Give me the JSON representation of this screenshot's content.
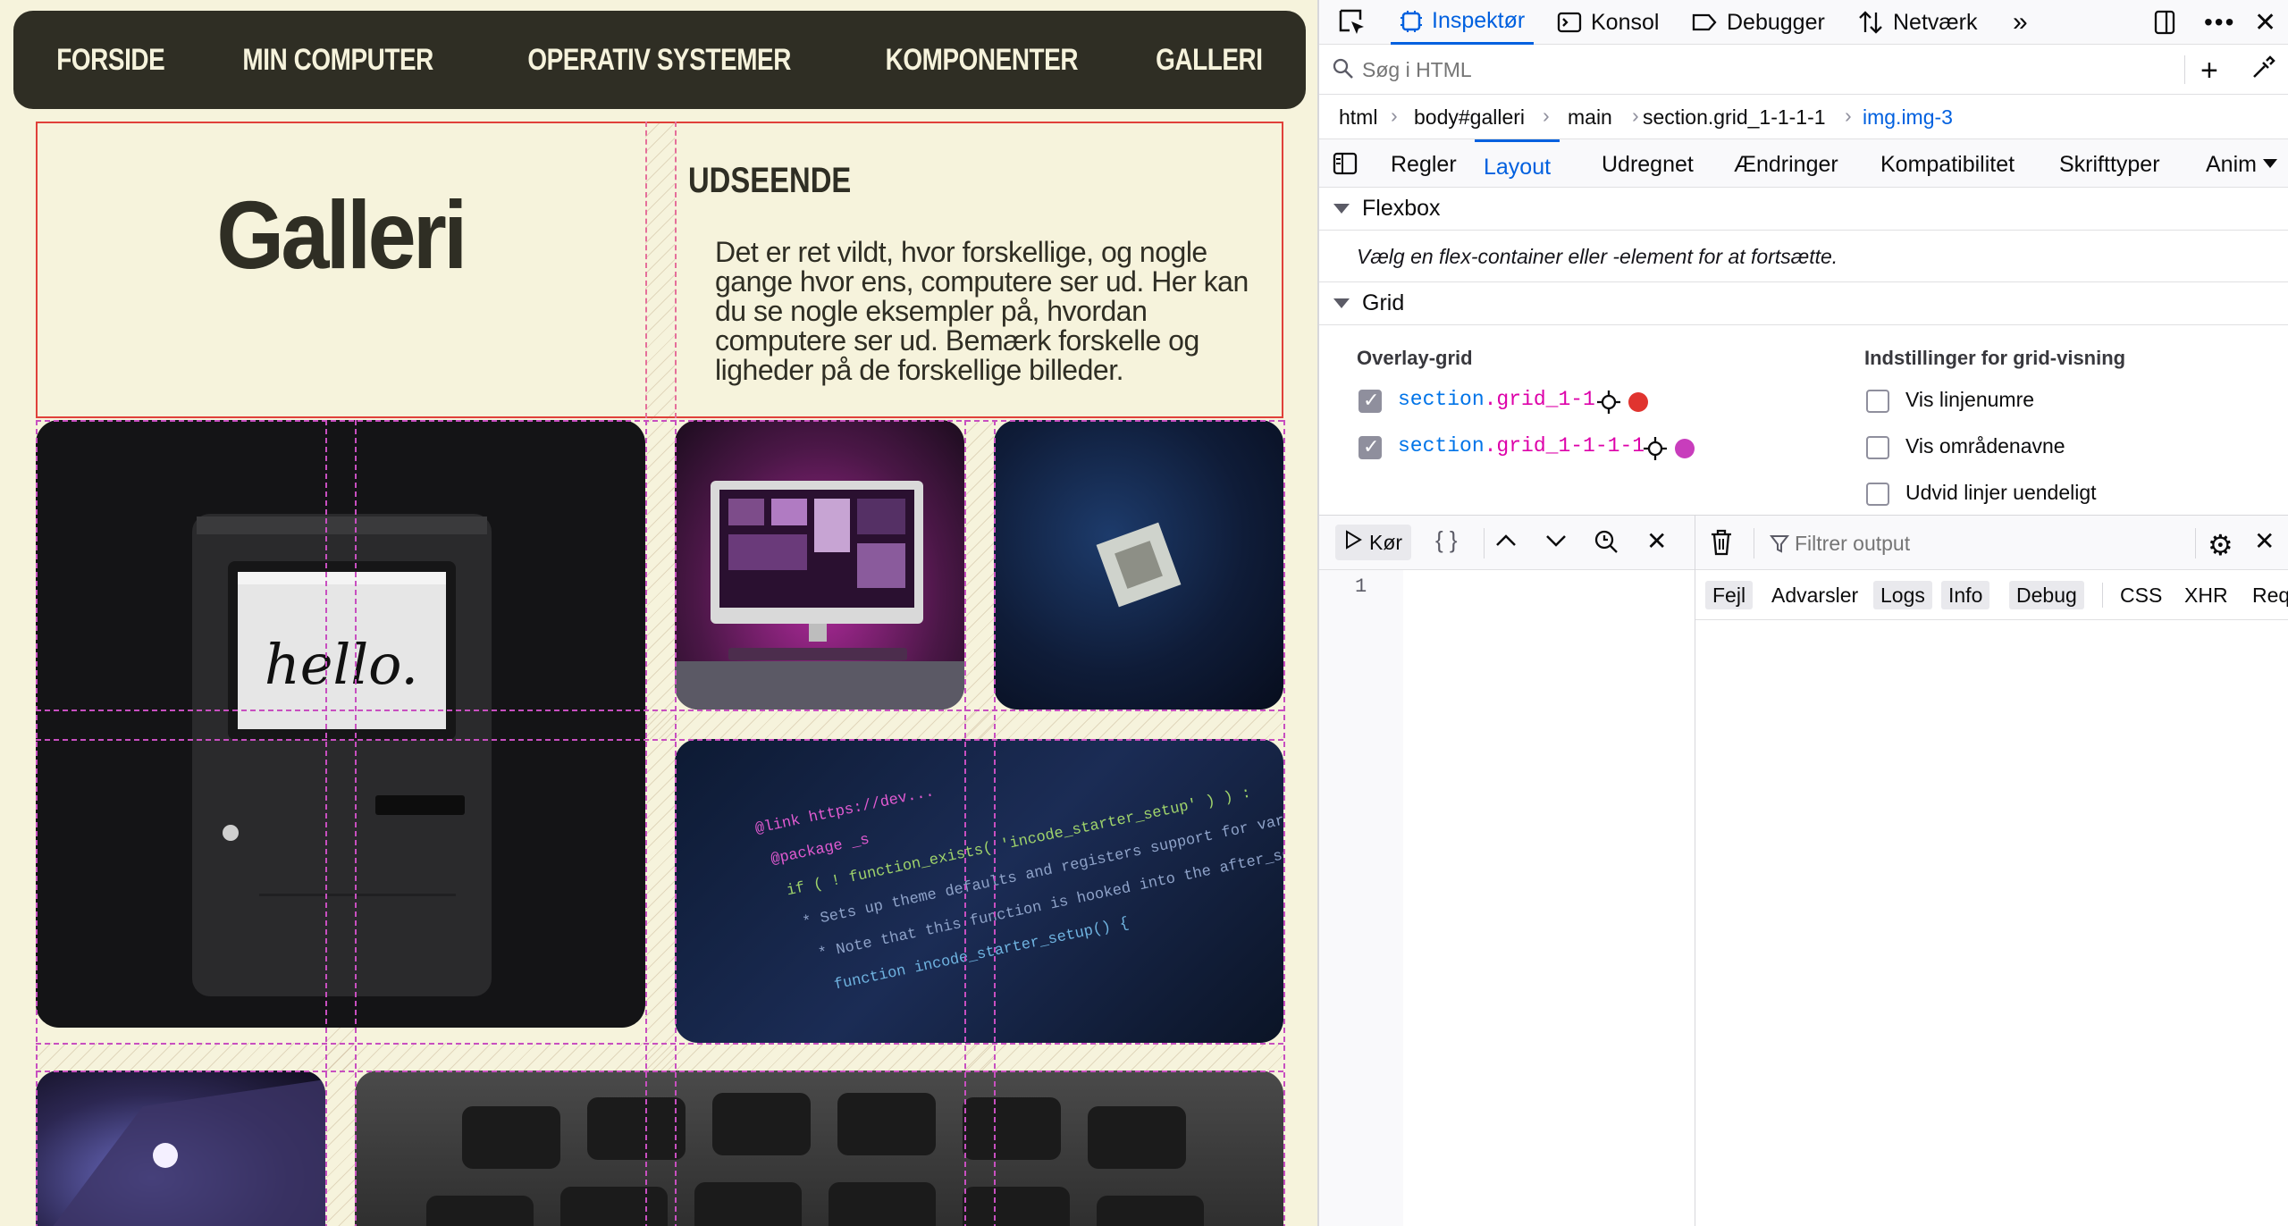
{
  "nav": [
    "FORSIDE",
    "MIN COMPUTER",
    "OPERATIV SYSTEMER",
    "KOMPONENTER",
    "GALLERI"
  ],
  "page": {
    "title": "Galleri",
    "section_title": "UDSEENDE",
    "intro": "Det er ret vildt, hvor forskellige, og nogle gange hvor ens, computere ser ud. Her kan du se nogle eksempler på, hvordan computere ser ud. Bemærk forskelle og ligheder på de forskellige billeder."
  },
  "images": {
    "mac_screen_text": "hello.",
    "code_lines": [
      "@link https://dev...",
      "@package _s",
      "if ( ! function_exists( 'incode_starter_setup' ) ) :",
      "* Sets up theme defaults and registers support for various WordPress",
      "* Note that this function is hooked into the after_setup_theme hook",
      "function incode_starter_setup() {"
    ]
  },
  "devtools": {
    "tabs": [
      "Inspektør",
      "Konsol",
      "Debugger",
      "Netværk"
    ],
    "search_placeholder": "Søg i HTML",
    "breadcrumbs": [
      "html",
      "body#galleri",
      "main",
      "section.grid_1-1-1-1",
      "img.img-3"
    ],
    "subtabs": [
      "Regler",
      "Layout",
      "Udregnet",
      "Ændringer",
      "Kompatibilitet",
      "Skrifttyper",
      "Anima"
    ],
    "flexbox": {
      "header": "Flexbox",
      "message": "Vælg en flex-container eller -element for at fortsætte."
    },
    "grid": {
      "header": "Grid",
      "overlay_title": "Overlay-grid",
      "overlays": [
        {
          "tag": "section",
          "cls": ".grid_1-1",
          "color": "#e0342f",
          "checked": true
        },
        {
          "tag": "section",
          "cls": ".grid_1-1-1-1",
          "color": "#c83dbc",
          "checked": true
        }
      ],
      "settings_title": "Indstillinger for grid-visning",
      "settings": [
        "Vis linjenumre",
        "Vis områdenavne",
        "Udvid linjer uendeligt"
      ]
    },
    "console": {
      "run_label": "Kør",
      "filter_placeholder": "Filtrer output",
      "line_number": "1",
      "levels": [
        "Fejl",
        "Advarsler",
        "Logs",
        "Info",
        "Debug"
      ],
      "types": [
        "CSS",
        "XHR",
        "Req"
      ]
    }
  }
}
